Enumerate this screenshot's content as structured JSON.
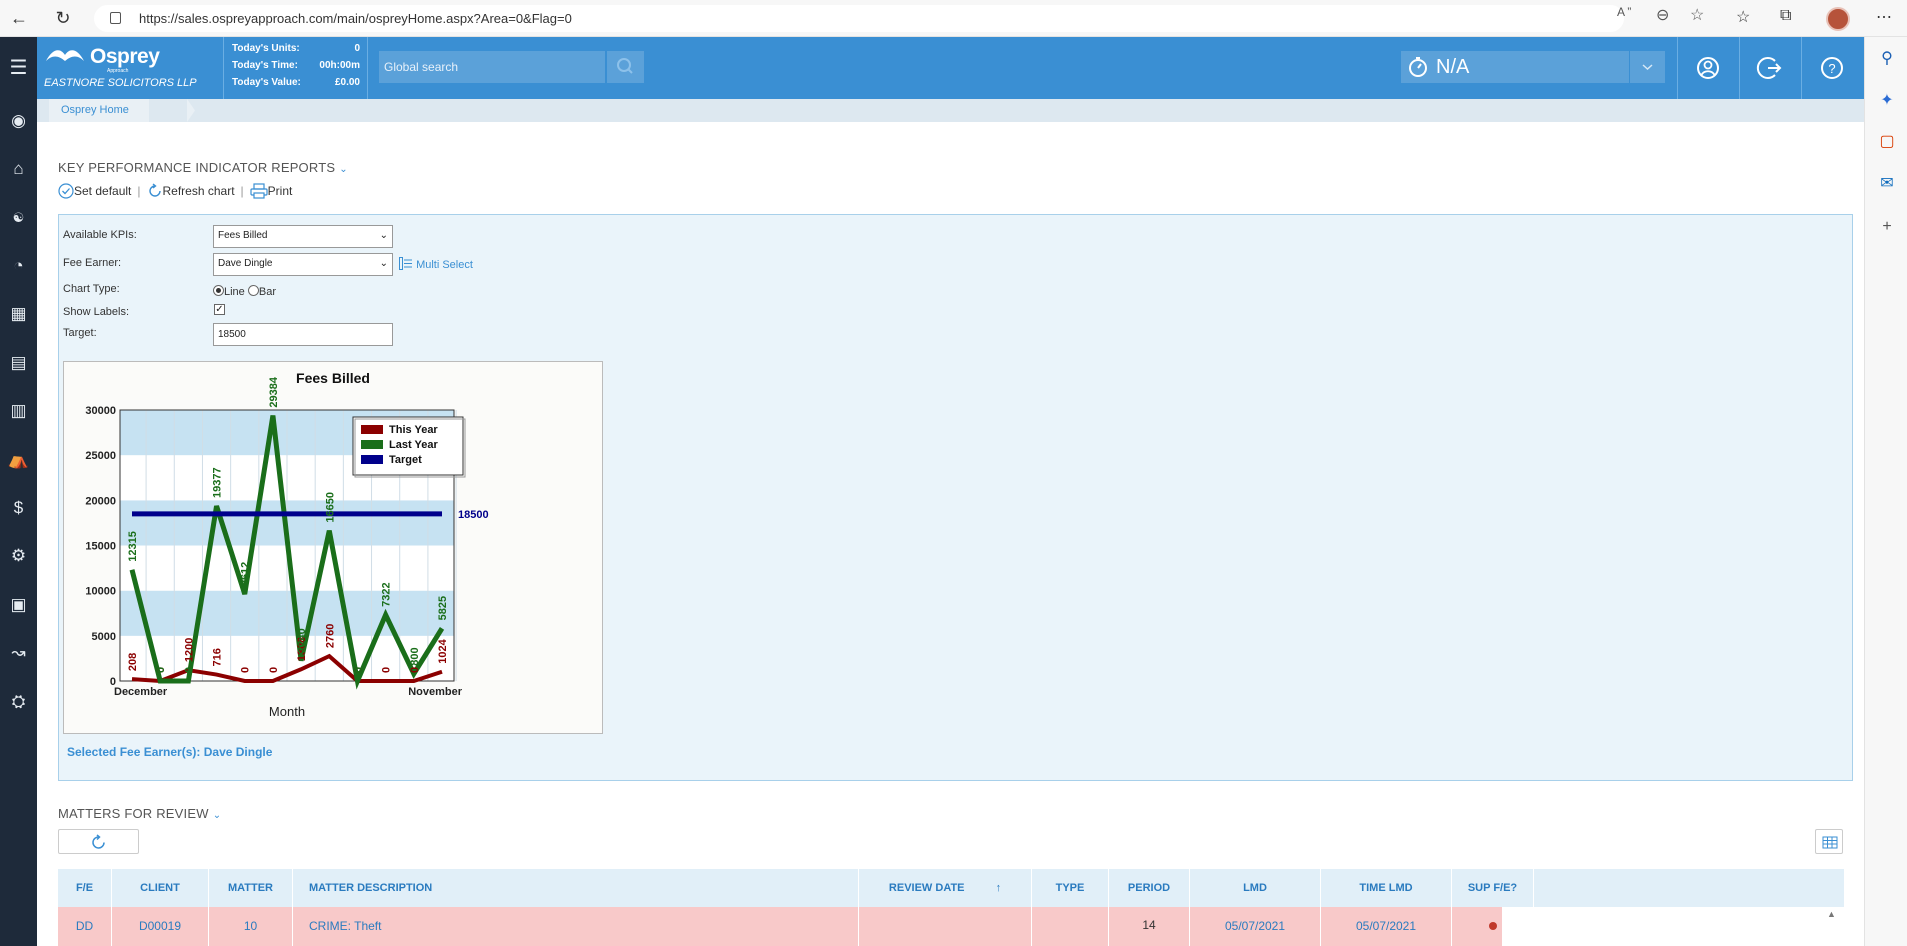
{
  "browser": {
    "url": "https://sales.ospreyapproach.com/main/ospreyHome.aspx?Area=0&Flag=0"
  },
  "header": {
    "logo_text": "Osprey",
    "logo_sub": "Approach",
    "firm_name": "EASTNORE SOLICITORS LLP",
    "stats": [
      {
        "label": "Today's Units:",
        "value": "0"
      },
      {
        "label": "Today's Time:",
        "value": "00h:00m"
      },
      {
        "label": "Today's Value:",
        "value": "£0.00"
      }
    ],
    "search_placeholder": "Global search",
    "timer_value": "N/A"
  },
  "breadcrumb": {
    "home": "Osprey Home"
  },
  "kpi": {
    "title": "KEY PERFORMANCE INDICATOR REPORTS",
    "actions": {
      "set_default": "Set default",
      "refresh_chart": "Refresh chart",
      "print": "Print"
    },
    "form": {
      "available_kpis_label": "Available KPIs:",
      "available_kpis_value": "Fees Billed",
      "fee_earner_label": "Fee Earner:",
      "fee_earner_value": "Dave Dingle",
      "multi_select": "Multi Select",
      "chart_type_label": "Chart Type:",
      "chart_type_line": "Line",
      "chart_type_bar": "Bar",
      "chart_type_selected": "Line",
      "show_labels_label": "Show Labels:",
      "show_labels_checked": true,
      "target_label": "Target:",
      "target_value": "18500"
    },
    "selected_fee_earners": "Selected Fee Earner(s): Dave Dingle"
  },
  "chart_data": {
    "type": "line",
    "title": "Fees Billed",
    "xlabel": "Month",
    "ylabel": "",
    "x_tick_labels": [
      "December",
      "November"
    ],
    "ylim": [
      0,
      30000
    ],
    "yticks": [
      0,
      5000,
      10000,
      15000,
      20000,
      25000,
      30000
    ],
    "legend": [
      "This Year",
      "Last Year",
      "Target"
    ],
    "legend_position": "top-right",
    "target_label": "18500",
    "series": [
      {
        "name": "This Year",
        "color": "#8b0000",
        "values": [
          208,
          0,
          1200,
          716,
          0,
          0,
          1300,
          2760,
          0,
          0,
          0,
          1024
        ],
        "labels": [
          "208",
          "0",
          "1200",
          "716",
          "0",
          "0",
          "1308",
          "2760",
          "0",
          "0",
          "0",
          "1024"
        ]
      },
      {
        "name": "Last Year",
        "color": "#1a6e1a",
        "values": [
          12315,
          0,
          0,
          19377,
          9612,
          29384,
          2240,
          16650,
          0,
          7322,
          800,
          5825
        ],
        "labels": [
          "12315",
          "0",
          "0",
          "19377",
          "9612",
          "29384",
          "2240",
          "16650",
          "0",
          "7322",
          "800",
          "5825"
        ]
      },
      {
        "name": "Target",
        "color": "#00008b",
        "values": [
          18500,
          18500,
          18500,
          18500,
          18500,
          18500,
          18500,
          18500,
          18500,
          18500,
          18500,
          18500
        ]
      }
    ]
  },
  "matters": {
    "title": "MATTERS FOR REVIEW",
    "columns": [
      "F/E",
      "CLIENT",
      "MATTER",
      "MATTER DESCRIPTION",
      "REVIEW DATE",
      "TYPE",
      "PERIOD",
      "LMD",
      "TIME LMD",
      "SUP F/E?"
    ],
    "sort_indicator": "↑",
    "rows": [
      {
        "fe": "DD",
        "client": "D00019",
        "matter": "10",
        "description": "CRIME: Theft",
        "review_date": "",
        "type": "",
        "period": "14",
        "lmd": "05/07/2021",
        "time_lmd": "05/07/2021",
        "sup_fe_color": "#c0392b"
      }
    ]
  }
}
